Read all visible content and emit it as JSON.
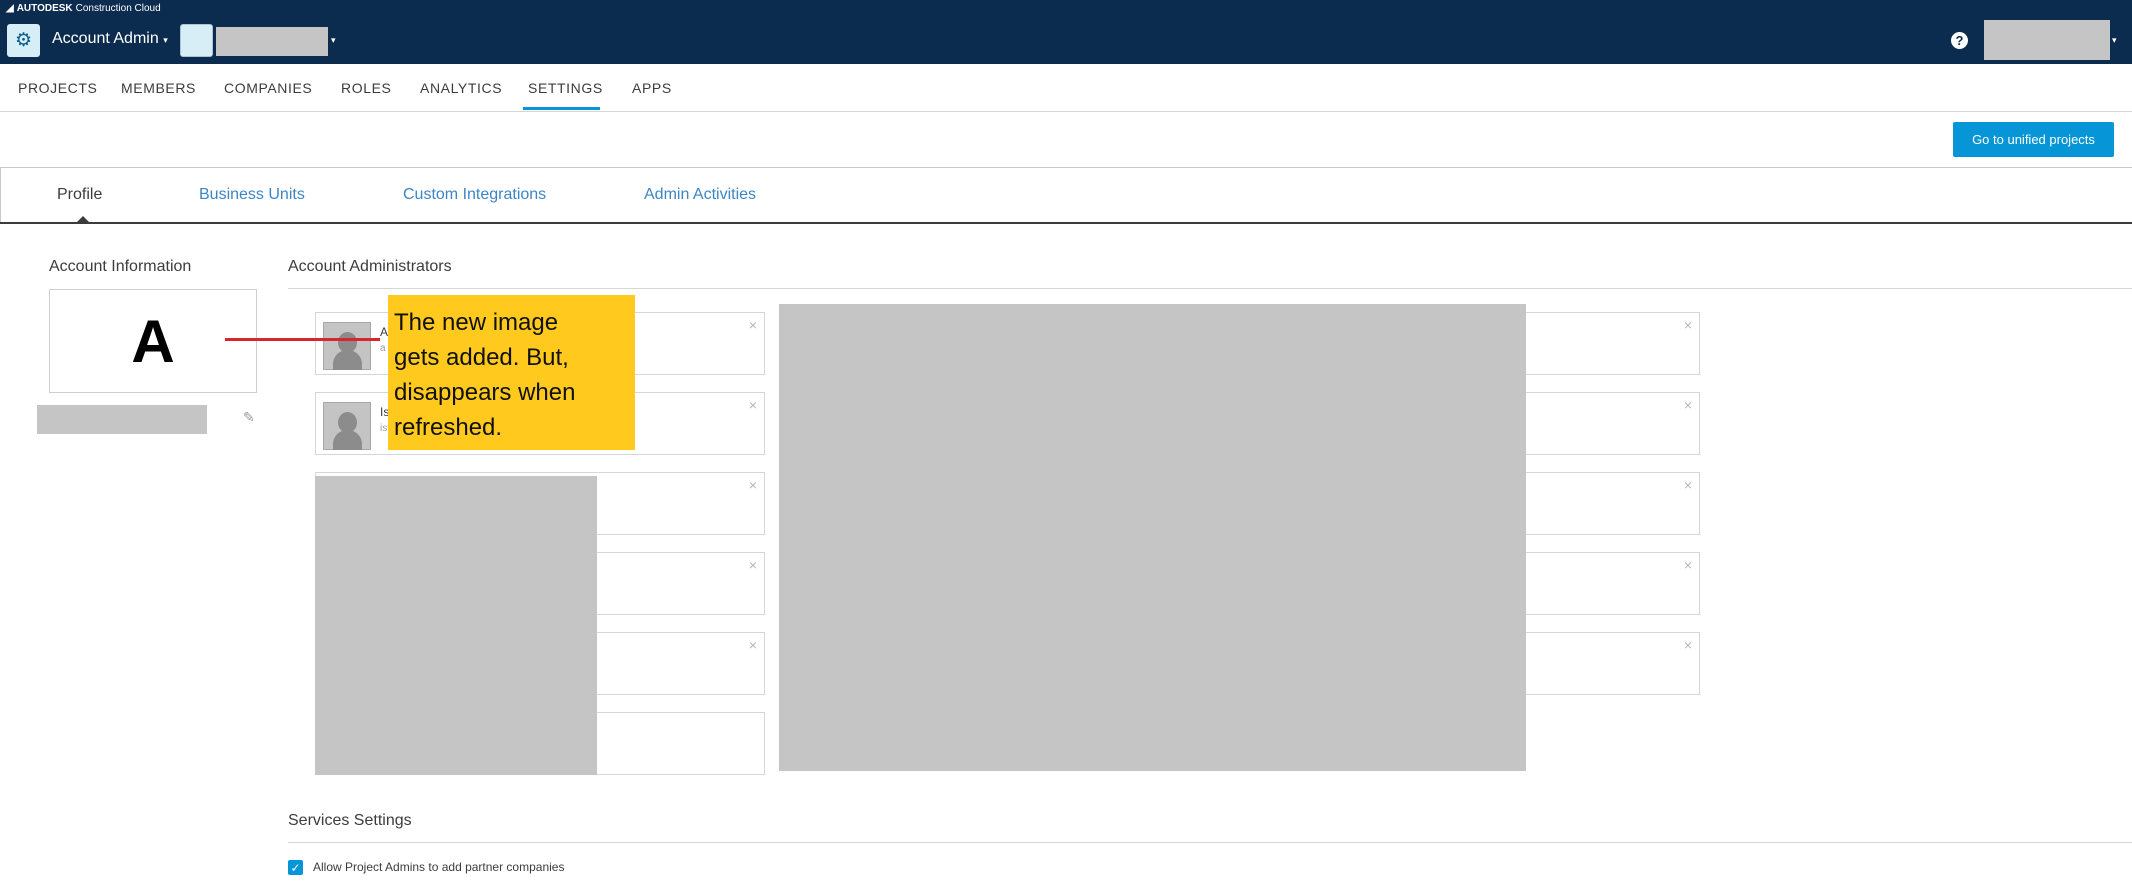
{
  "header": {
    "brand_logo": "AUTODESK",
    "brand_product": "Construction Cloud",
    "gear_icon": "gear-icon",
    "account_label": "Account Admin",
    "caret": "▾",
    "help_icon": "?"
  },
  "main_nav": {
    "tabs": [
      {
        "label": "PROJECTS"
      },
      {
        "label": "MEMBERS"
      },
      {
        "label": "COMPANIES"
      },
      {
        "label": "ROLES"
      },
      {
        "label": "ANALYTICS"
      },
      {
        "label": "SETTINGS",
        "active": true
      },
      {
        "label": "APPS"
      }
    ]
  },
  "toolbar": {
    "unified_button": "Go to unified projects"
  },
  "sub_tabs": [
    {
      "label": "Profile",
      "active": true
    },
    {
      "label": "Business Units"
    },
    {
      "label": "Custom Integrations"
    },
    {
      "label": "Admin Activities"
    }
  ],
  "account_info": {
    "title": "Account Information",
    "logo_letter": "A",
    "edit_icon": "✎"
  },
  "admins": {
    "title": "Account Administrators",
    "cards": [
      {
        "name": "A",
        "email": "a"
      },
      {
        "name": "Is",
        "email": "is"
      }
    ],
    "close_icon": "×"
  },
  "annotation": {
    "lines": [
      "The new image",
      "gets added. But,",
      "disappears when",
      "refreshed."
    ]
  },
  "services": {
    "title": "Services Settings",
    "allow_partner_label": "Allow Project Admins to add partner companies",
    "allow_partner_checked": true,
    "check_icon": "✓"
  },
  "colors": {
    "header_bg": "#0b2b4f",
    "accent": "#0696d7",
    "link": "#3c86c6",
    "annotation_bg": "#ffc91d",
    "annotation_line": "#d9262c"
  }
}
